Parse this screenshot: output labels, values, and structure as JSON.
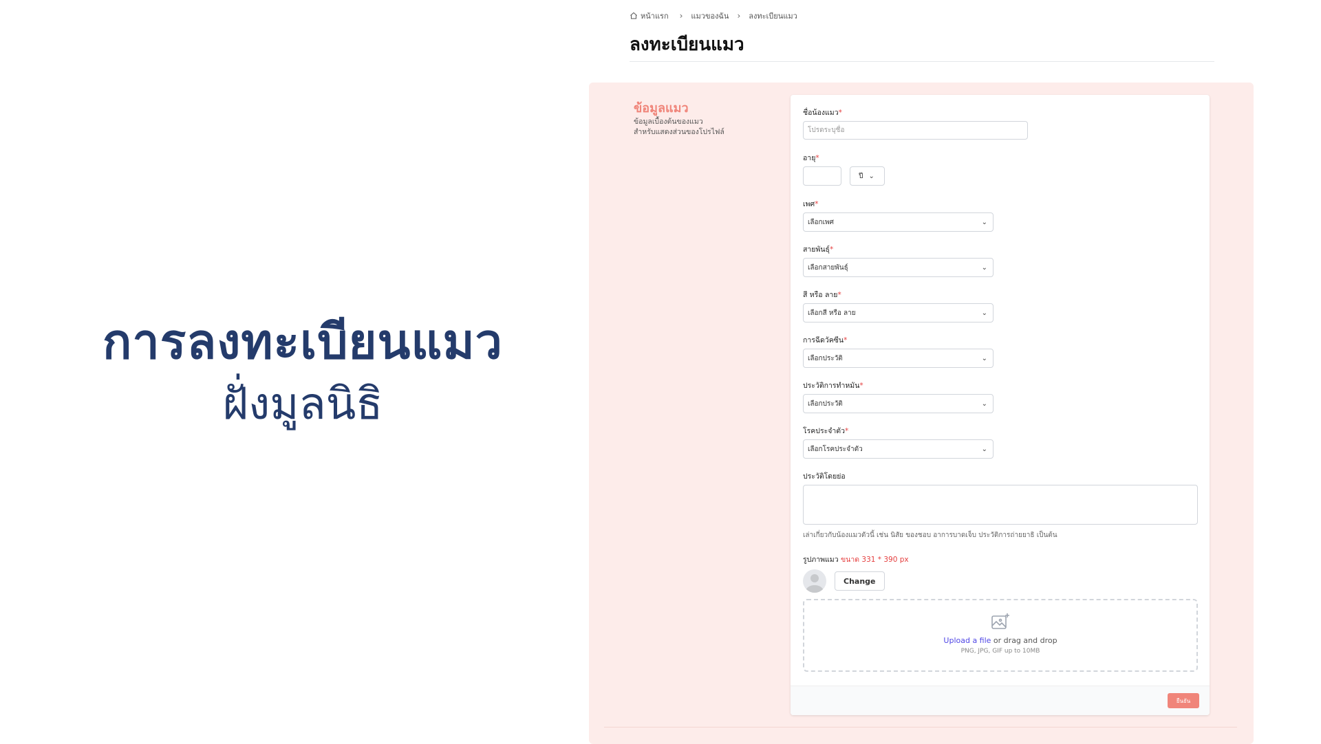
{
  "slide": {
    "title": "การลงทะเบียนแมว",
    "subtitle": "ฝั่งมูลนิธิ"
  },
  "breadcrumb": {
    "home": "หน้าแรก",
    "items": [
      "แมวของฉัน",
      "ลงทะเบียนแมว"
    ]
  },
  "page_title": "ลงทะเบียนแมว",
  "section": {
    "title": "ข้อมูลแมว",
    "desc_line1": "ข้อมูลเบื้องต้นของแมว",
    "desc_line2": "สำหรับแสดงส่วนของโปรไฟล์"
  },
  "form": {
    "name": {
      "label": "ชื่อน้องแมว",
      "required": "*",
      "placeholder": "โปรดระบุชื่อ"
    },
    "age": {
      "label": "อายุ",
      "required": "*",
      "value": "",
      "unit": "ปี"
    },
    "gender": {
      "label": "เพศ",
      "required": "*",
      "value": "เลือกเพศ"
    },
    "breed": {
      "label": "สายพันธุ์",
      "required": "*",
      "value": "เลือกสายพันธุ์"
    },
    "color": {
      "label": "สี หรือ ลาย",
      "required": "*",
      "value": "เลือกสี หรือ ลาย"
    },
    "vaccine": {
      "label": "การฉีดวัคซีน",
      "required": "*",
      "value": "เลือกประวัติ"
    },
    "sterilization": {
      "label": "ประวัติการทำหมัน",
      "required": "*",
      "value": "เลือกประวัติ"
    },
    "disease": {
      "label": "โรคประจำตัว",
      "required": "*",
      "value": "เลือกโรคประจำตัว"
    },
    "bio": {
      "label": "ประวัติโดยย่อ",
      "hint": "เล่าเกี่ยวกับน้องแมวตัวนี้ เช่น นิสัย ของชอบ อาการบาดเจ็บ ประวัติการถ่ายยาธิ เป็นต้น"
    },
    "photo": {
      "label": "รูปภาพแมว",
      "size_note": "ขนาด 331 * 390 px",
      "change": "Change"
    },
    "upload": {
      "link": "Upload a file",
      "text": " or drag and drop",
      "note": "PNG, JPG, GIF up to 10MB"
    },
    "submit": "ยืนยัน"
  },
  "colors": {
    "accent": "#f0857a",
    "panel_bg": "#fdecea",
    "slide_title": "#243b6b",
    "link": "#4f46e5"
  }
}
